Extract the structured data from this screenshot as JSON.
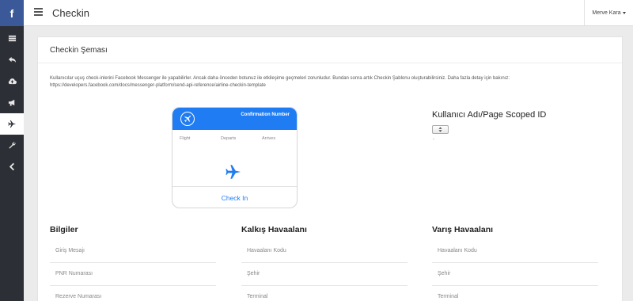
{
  "sidebar": {
    "logo": "f",
    "icons": [
      "list-icon",
      "reply-icon",
      "cloud-upload-icon",
      "bullhorn-icon",
      "plane-icon",
      "wrench-icon",
      "chevron-left-icon"
    ],
    "active_index": 4
  },
  "topbar": {
    "title": "Checkin",
    "user": "Merve Kara"
  },
  "panel": {
    "title": "Checkin Şeması",
    "description_line1": "Kullanıcılar uçuş check-inlerini Facebook Messenger ile yapabilirler. Ancak daha önceden botunuz ile etkileşime geçmeleri zorunludur. Bundan sonra artık Checkin Şablonu oluşturabilirsiniz. Daha fazla detay için bakınız:",
    "description_line2": "https://developers.facebook.com/docs/messenger-platform/send-api-reference/airline-checkin-template"
  },
  "card": {
    "confirmation": "Confirmation Number",
    "col_flight": "Flight",
    "col_departs": "Departs",
    "col_arrives": "Arrives",
    "button": "Check In",
    "accent": "#1f7cf3"
  },
  "user_id": {
    "title": "Kullanıcı Adı/Page Scoped ID",
    "value": "-"
  },
  "columns": [
    {
      "title": "Bilgiler",
      "fields": [
        "Giriş Mesajı",
        "PNR Numarası",
        "Rezerve Numarası"
      ]
    },
    {
      "title": "Kalkış Havaalanı",
      "fields": [
        "Havaalanı Kodu",
        "Şehir",
        "Terminal"
      ]
    },
    {
      "title": "Varış Havaalanı",
      "fields": [
        "Havaalanı Kodu",
        "Şehir",
        "Terminal"
      ]
    }
  ]
}
